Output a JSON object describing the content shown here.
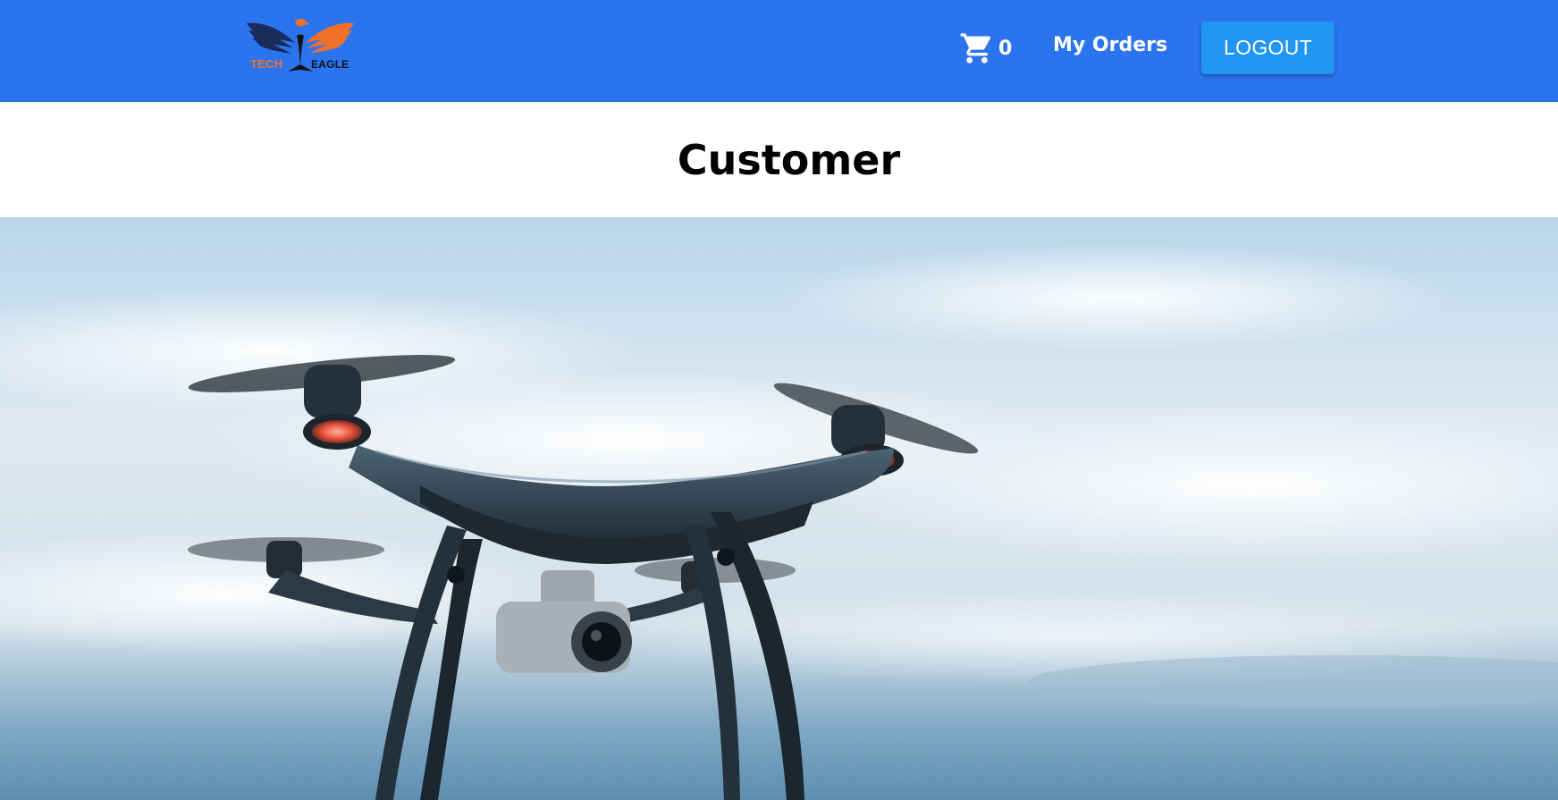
{
  "header": {
    "brand": {
      "logo_text_left": "TECH",
      "logo_text_right": "EAGLE",
      "logo_icon": "eagle-logo-icon"
    },
    "cart": {
      "icon": "shopping-cart-icon",
      "count": "0"
    },
    "my_orders_label": "My Orders",
    "logout_label": "LOGOUT"
  },
  "main": {
    "title": "Customer",
    "hero_image": {
      "subject": "quadcopter-drone-in-sky"
    }
  },
  "colors": {
    "navbar": "#2b74ee",
    "logout_button": "#2196f3",
    "logo_orange": "#f0702a",
    "logo_navy": "#1a2a5a"
  }
}
